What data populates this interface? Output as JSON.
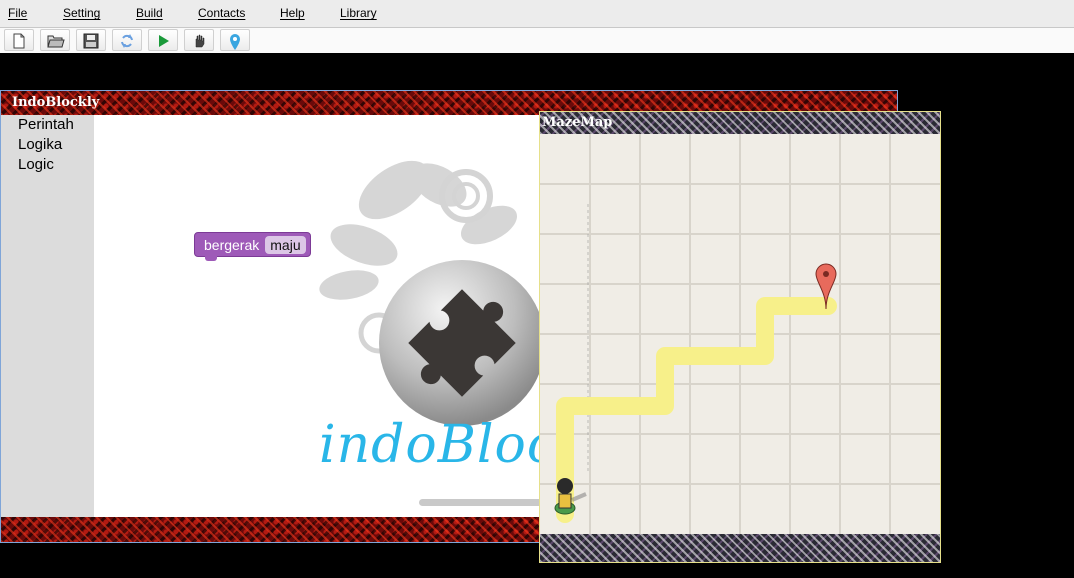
{
  "menu": [
    "File",
    "Setting",
    "Build",
    "Contacts",
    "Help",
    "Library"
  ],
  "toolbar": {
    "buttons": [
      "new-file-icon",
      "open-folder-icon",
      "save-icon",
      "refresh-icon",
      "run-icon",
      "hand-icon",
      "map-pin-icon"
    ]
  },
  "indoblockly": {
    "title": "IndoBlockly",
    "categories": [
      "Perintah",
      "Logika",
      "Logic"
    ],
    "block": {
      "label": "bergerak",
      "field": "maju"
    },
    "logo_text": "indoBlockly"
  },
  "mazemap": {
    "title": "MazeMap"
  },
  "colors": {
    "block": "#9e5ab8",
    "path": "#f7f08a",
    "logo": "#29b6e8",
    "marker": "#e86a5c"
  }
}
